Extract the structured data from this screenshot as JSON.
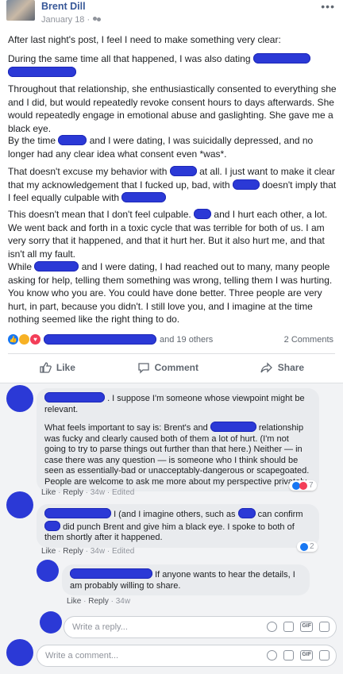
{
  "post": {
    "author": "Brent Dill",
    "date": "January 18 ·",
    "more": "•••",
    "paragraphs": {
      "p1": "After last night's post, I feel I need to make something very clear:",
      "p2a": "During the same time all that happened, I was also dating",
      "p3": "Throughout that relationship, she enthusiastically consented to everything she and I did, but would repeatedly revoke consent hours to days afterwards. She would repeatedly engage in emotional abuse and gaslighting. She gave me a black eye.",
      "p4a": "By the time",
      "p4b": "and I were dating, I was suicidally depressed, and no longer had any clear idea what consent even *was*.",
      "p5a": "That doesn't excuse my behavior with",
      "p5b": "at all. I just want to make it clear that my acknowledgement that I fucked up, bad, with",
      "p5c": "doesn't imply that I feel equally culpable with",
      "p6a": "This doesn't mean that I don't feel culpable.",
      "p6b": "and I hurt each other, a lot. We went back and forth in a toxic cycle that was terrible for both of us. I am very sorry that it happened, and that it hurt her. But it also hurt me, and that isn't all my fault.",
      "p7a": "While",
      "p7b": "and I were dating, I had reached out to many, many people asking for help, telling them something was wrong, telling them I was hurting. You know who you are. You could have done better. Three people are very hurt, in part, because you didn't. I still love you, and I imagine at the time nothing seemed like the right thing to do."
    },
    "reactions_text": "and 19 others",
    "comments_count": "2 Comments",
    "actions": {
      "like": "Like",
      "comment": "Comment",
      "share": "Share"
    }
  },
  "comments": [
    {
      "text_a": ". I suppose I'm someone whose viewpoint might be relevant.",
      "text_b": "What feels important to say is: Brent's and",
      "text_c": "relationship was fucky and clearly caused both of them a lot of hurt. (I'm not going to try to parse things out further than that here.) Neither — in case there was any question — is someone who I think should be seen as essentially-bad or unacceptably-dangerous or scapegoated. People are welcome to ask me more about my perspective privately.",
      "like": "Like",
      "reply": "Reply",
      "time": "34w",
      "edited": "Edited",
      "reaction_count": "7"
    },
    {
      "text_a": "I (and I imagine others, such as",
      "text_b": "can confirm",
      "text_c": "did punch Brent and give him a black eye. I spoke to both of them shortly after it happened.",
      "like": "Like",
      "reply": "Reply",
      "time": "34w",
      "edited": "Edited",
      "reaction_count": "2"
    },
    {
      "text_a": "If anyone wants to hear the details, I am probably willing to share.",
      "like": "Like",
      "reply": "Reply",
      "time": "34w"
    }
  ],
  "reply_input": {
    "placeholder": "Write a reply..."
  },
  "comment_input": {
    "placeholder": "Write a comment..."
  },
  "colors": {
    "link": "#385898",
    "redaction": "#2b39d6",
    "comment_bg": "#f2f3f5",
    "bubble": "#e9ebee"
  }
}
